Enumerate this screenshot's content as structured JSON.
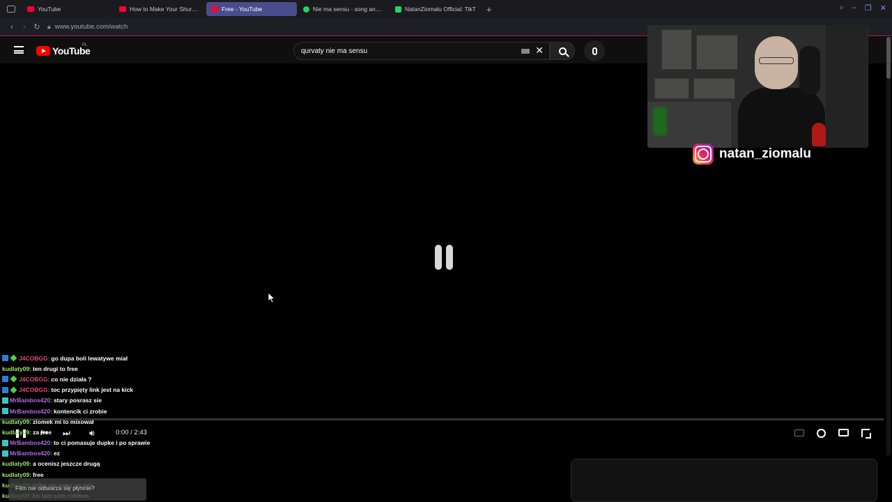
{
  "browser": {
    "tabs": [
      {
        "label": "YouTube",
        "icon": "youtube-favicon"
      },
      {
        "label": "How to Make Your Shure S",
        "icon": "youtube-favicon"
      },
      {
        "label": "Free - YouTube",
        "icon": "youtube-favicon",
        "active": true
      },
      {
        "label": "Nie ma sensu - song and ly",
        "icon": "spotify-favicon"
      },
      {
        "label": "NatanZiomalu Official: TikT",
        "icon": "tiktok-favicon"
      }
    ],
    "new_tab": "+",
    "url": "www.youtube.com/watch"
  },
  "youtube": {
    "logo_text": "YouTube",
    "country": "PL",
    "search_value": "qurvaty nie ma sensu"
  },
  "player": {
    "time": "0:00 / 2:43",
    "progress_fraction": 0
  },
  "webcam": {
    "instagram_handle": "natan_ziomalu"
  },
  "chat": [
    {
      "badges": [
        "mod",
        "verified"
      ],
      "user": "J4COBGG:",
      "user_color": "#e8457a",
      "message": "go dupa boli lewatywe miał"
    },
    {
      "badges": [],
      "user": "kudlaty09:",
      "user_color": "#9fe86a",
      "message": "ten drugi to free"
    },
    {
      "badges": [
        "mod",
        "verified"
      ],
      "user": "J4COBGG:",
      "user_color": "#e8457a",
      "message": "co nie działa ?"
    },
    {
      "badges": [
        "mod",
        "verified"
      ],
      "user": "J4COBGG:",
      "user_color": "#e8457a",
      "message": "toc przypięty link jest na kick"
    },
    {
      "badges": [
        "sub"
      ],
      "user": "MrBambos420:",
      "user_color": "#b06ae8",
      "message": "stary posrasz sie"
    },
    {
      "badges": [
        "sub"
      ],
      "user": "MrBambos420:",
      "user_color": "#b06ae8",
      "message": "kontencik ci zrobie"
    },
    {
      "badges": [],
      "user": "kudlaty09:",
      "user_color": "#9fe86a",
      "message": "ziomek mi to mixował"
    },
    {
      "badges": [],
      "user": "kudlaty09:",
      "user_color": "#9fe86a",
      "message": "za free"
    },
    {
      "badges": [
        "sub"
      ],
      "user": "MrBambos420:",
      "user_color": "#b06ae8",
      "message": "to ci pomasuje dupke i po sprawie"
    },
    {
      "badges": [
        "sub"
      ],
      "user": "MrBambos420:",
      "user_color": "#b06ae8",
      "message": "ez"
    },
    {
      "badges": [],
      "user": "kudlaty09:",
      "user_color": "#9fe86a",
      "message": "a ocenisz jeszcze drugą"
    },
    {
      "badges": [],
      "user": "kudlaty09:",
      "user_color": "#9fe86a",
      "message": "free"
    },
    {
      "badges": [],
      "user": "kudlaty09:",
      "user_color": "#9fe86a",
      "message": "tylko nie patrz na mix"
    },
    {
      "badges": [],
      "user": "kudlaty09:",
      "user_color": "#9fe86a",
      "message": "bo tam sam robiłem"
    }
  ],
  "tooltip": "Film nie odtwarza się płynnie?"
}
